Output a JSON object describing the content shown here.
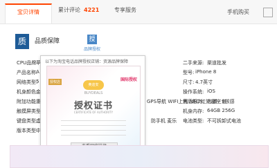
{
  "tabs": {
    "details": "宝贝详情",
    "reviews_label": "累计评论",
    "reviews_count": "4221",
    "service": "专享服务",
    "mobile": "手机购买"
  },
  "quality": {
    "label": "品质保障",
    "icon_char": "质"
  },
  "auth": {
    "label": "品牌授权",
    "icon_char": "授"
  },
  "popup": {
    "title": "以下为淘宝电话品牌授权店铺：资源品牌保障",
    "badge_left": "授权店",
    "badge_right": "国际授权",
    "logo_text": "奥迪安",
    "logo_name": "BUYDEALS",
    "heading": "授权证书",
    "sub": "CERTIFICATE OF AUTHORITY",
    "button": "查看网络链接"
  },
  "attrs": {
    "left": [
      {
        "k": "CPU品牌:",
        "v": "苹"
      },
      {
        "k": "产品名称:",
        "v": "A"
      },
      {
        "k": "网络类型:",
        "v": "5"
      },
      {
        "k": "机身颜色:",
        "v": "金"
      },
      {
        "k": "附加功能:",
        "v": "重"
      },
      {
        "k": "触摸屏类型:",
        "v": ""
      },
      {
        "k": "键盘类型:",
        "v": "虚"
      },
      {
        "k": "版本类型:",
        "v": "中"
      }
    ],
    "mid": [
      {
        "v": ""
      },
      {
        "v": ""
      },
      {
        "v": ""
      },
      {
        "v": ""
      },
      {
        "v": "GPS导航 WIFI上网 NFC 红外遥控 9核感"
      },
      {
        "v": ""
      },
      {
        "v": "防手机 麦乐"
      },
      {
        "v": ""
      }
    ],
    "right": [
      {
        "k": "二手来源:",
        "v": "渠道批发"
      },
      {
        "k": "型号:",
        "v": "iPhone 8"
      },
      {
        "k": "尺寸:",
        "v": "4.7英寸"
      },
      {
        "k": "操作系统:",
        "v": "iOS"
      },
      {
        "k": "售后服务:",
        "v": "店铺三包"
      },
      {
        "k": "机身内存:",
        "v": "64GB 256G"
      },
      {
        "k": "电池类型:",
        "v": "不可拆卸式电池"
      },
      {
        "k": "",
        "v": ""
      }
    ]
  }
}
